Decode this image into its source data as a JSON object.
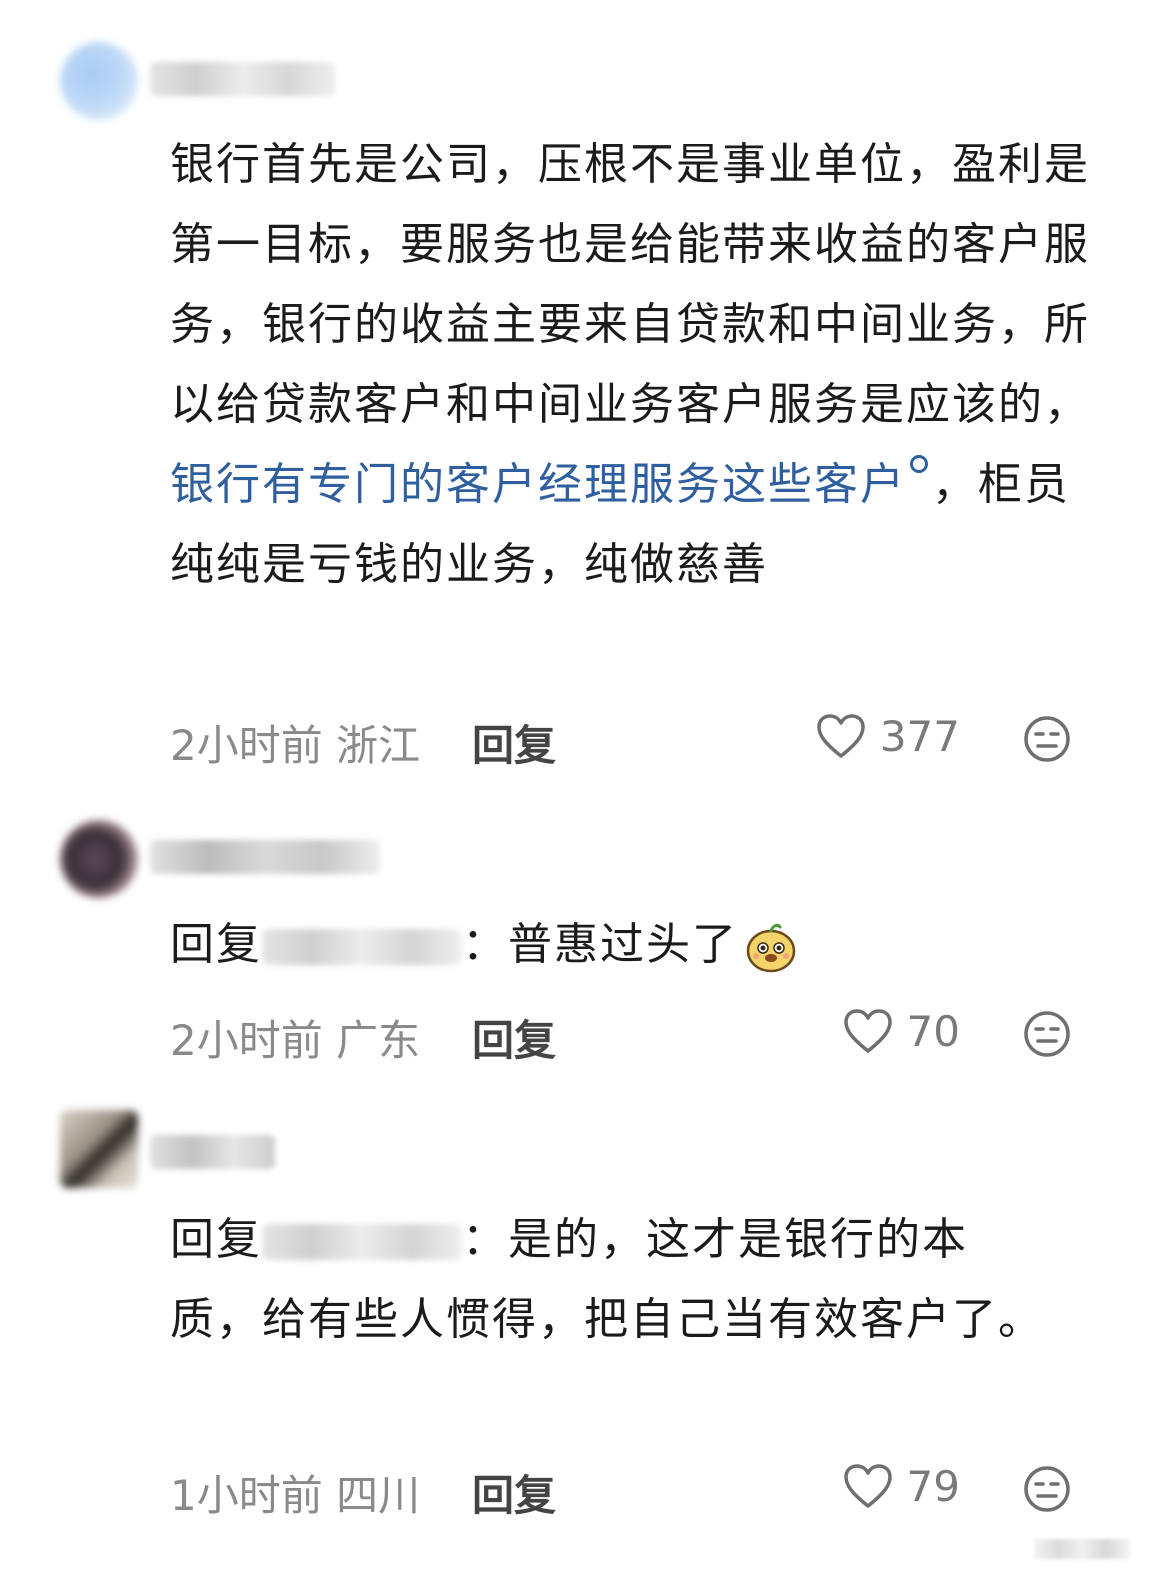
{
  "comments": [
    {
      "body_segments": {
        "plain1": "银行首先是公司，压根不是事业单位，盈利是第一目标，要服务也是给能带来收益的客户服务，银行的收益主要来自贷款和中间业务，所以给贷款客户和中间业务客户服务是应该的，",
        "link": "银行有专门的客户经理服务这些客户",
        "plain2": "，柜员纯纯是亏钱的业务，纯做慈善"
      },
      "time": "2小时前",
      "location": "浙江",
      "reply_label": "回复",
      "likes": "377"
    },
    {
      "reply_prefix": "回复",
      "colon": "：",
      "body": "普惠过头了",
      "emoji": "smiling-face-sticker",
      "time": "2小时前",
      "location": "广东",
      "reply_label": "回复",
      "likes": "70"
    },
    {
      "reply_prefix": "回复",
      "colon": "：",
      "body": "是的，这才是银行的本质，给有些人惯得，把自己当有效客户了。",
      "time": "1小时前",
      "location": "四川",
      "reply_label": "回复",
      "likes": "79"
    }
  ],
  "icons": {
    "like": "heart-outline-icon",
    "dislike": "neutral-face-icon",
    "link_search": "search-icon"
  },
  "colors": {
    "link": "#2f5f9e",
    "meta": "#8a8a8a",
    "text": "#1b1b1b"
  }
}
